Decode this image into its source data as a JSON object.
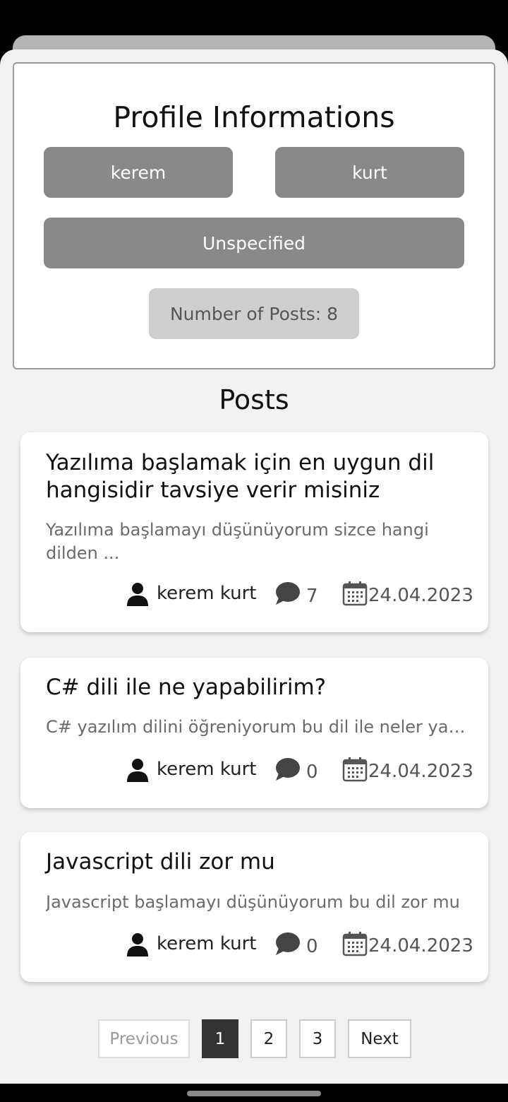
{
  "profile": {
    "title": "Profile Informations",
    "first_name": "kerem",
    "last_name": "kurt",
    "gender": "Unspecified",
    "posts_count": "Number of Posts: 8"
  },
  "posts_heading": "Posts",
  "posts": [
    {
      "title": "Yazılıma başlamak için en uygun dil hangisidir tavsiye verir misiniz",
      "excerpt": "Yazılıma başlamayı düşünüyorum sizce hangi dilden ...",
      "author": "kerem kurt",
      "comments": "7",
      "date": "24.04.2023"
    },
    {
      "title": "C# dili ile ne yapabilirim?",
      "excerpt": "C# yazılım dilini öğreniyorum bu dil ile neler yap...",
      "author": "kerem kurt",
      "comments": "0",
      "date": "24.04.2023"
    },
    {
      "title": "Javascript dili zor mu",
      "excerpt": "Javascript başlamayı düşünüyorum bu dil zor mu",
      "author": "kerem kurt",
      "comments": "0",
      "date": "24.04.2023"
    }
  ],
  "pagination": {
    "previous": "Previous",
    "pages": [
      "1",
      "2",
      "3"
    ],
    "current_page": "1",
    "next": "Next"
  },
  "icons": {
    "author": "user-icon",
    "comments": "comment-icon",
    "date": "calendar-icon"
  },
  "colors": {
    "pill": "#898989",
    "count_badge": "#d0cfcf",
    "active_page": "#333333"
  }
}
